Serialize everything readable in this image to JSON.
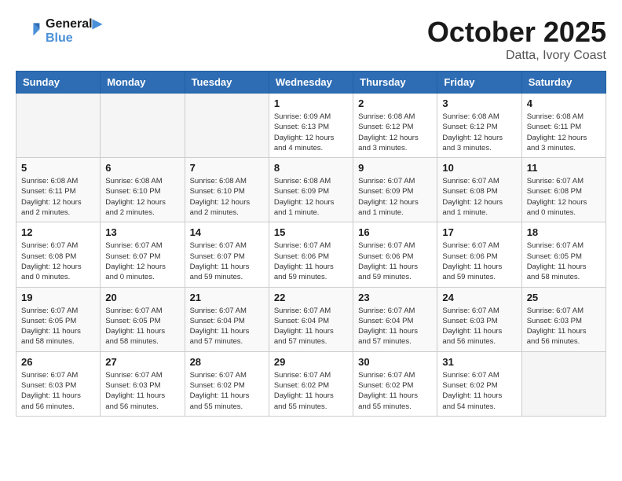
{
  "header": {
    "logo_line1": "General",
    "logo_line2": "Blue",
    "month_title": "October 2025",
    "location": "Datta, Ivory Coast"
  },
  "days_of_week": [
    "Sunday",
    "Monday",
    "Tuesday",
    "Wednesday",
    "Thursday",
    "Friday",
    "Saturday"
  ],
  "weeks": [
    [
      {
        "day": "",
        "empty": true
      },
      {
        "day": "",
        "empty": true
      },
      {
        "day": "",
        "empty": true
      },
      {
        "day": "1",
        "sunrise": "6:09 AM",
        "sunset": "6:13 PM",
        "daylight": "12 hours and 4 minutes."
      },
      {
        "day": "2",
        "sunrise": "6:08 AM",
        "sunset": "6:12 PM",
        "daylight": "12 hours and 3 minutes."
      },
      {
        "day": "3",
        "sunrise": "6:08 AM",
        "sunset": "6:12 PM",
        "daylight": "12 hours and 3 minutes."
      },
      {
        "day": "4",
        "sunrise": "6:08 AM",
        "sunset": "6:11 PM",
        "daylight": "12 hours and 3 minutes."
      }
    ],
    [
      {
        "day": "5",
        "sunrise": "6:08 AM",
        "sunset": "6:11 PM",
        "daylight": "12 hours and 2 minutes."
      },
      {
        "day": "6",
        "sunrise": "6:08 AM",
        "sunset": "6:10 PM",
        "daylight": "12 hours and 2 minutes."
      },
      {
        "day": "7",
        "sunrise": "6:08 AM",
        "sunset": "6:10 PM",
        "daylight": "12 hours and 2 minutes."
      },
      {
        "day": "8",
        "sunrise": "6:08 AM",
        "sunset": "6:09 PM",
        "daylight": "12 hours and 1 minute."
      },
      {
        "day": "9",
        "sunrise": "6:07 AM",
        "sunset": "6:09 PM",
        "daylight": "12 hours and 1 minute."
      },
      {
        "day": "10",
        "sunrise": "6:07 AM",
        "sunset": "6:08 PM",
        "daylight": "12 hours and 1 minute."
      },
      {
        "day": "11",
        "sunrise": "6:07 AM",
        "sunset": "6:08 PM",
        "daylight": "12 hours and 0 minutes."
      }
    ],
    [
      {
        "day": "12",
        "sunrise": "6:07 AM",
        "sunset": "6:08 PM",
        "daylight": "12 hours and 0 minutes."
      },
      {
        "day": "13",
        "sunrise": "6:07 AM",
        "sunset": "6:07 PM",
        "daylight": "12 hours and 0 minutes."
      },
      {
        "day": "14",
        "sunrise": "6:07 AM",
        "sunset": "6:07 PM",
        "daylight": "11 hours and 59 minutes."
      },
      {
        "day": "15",
        "sunrise": "6:07 AM",
        "sunset": "6:06 PM",
        "daylight": "11 hours and 59 minutes."
      },
      {
        "day": "16",
        "sunrise": "6:07 AM",
        "sunset": "6:06 PM",
        "daylight": "11 hours and 59 minutes."
      },
      {
        "day": "17",
        "sunrise": "6:07 AM",
        "sunset": "6:06 PM",
        "daylight": "11 hours and 59 minutes."
      },
      {
        "day": "18",
        "sunrise": "6:07 AM",
        "sunset": "6:05 PM",
        "daylight": "11 hours and 58 minutes."
      }
    ],
    [
      {
        "day": "19",
        "sunrise": "6:07 AM",
        "sunset": "6:05 PM",
        "daylight": "11 hours and 58 minutes."
      },
      {
        "day": "20",
        "sunrise": "6:07 AM",
        "sunset": "6:05 PM",
        "daylight": "11 hours and 58 minutes."
      },
      {
        "day": "21",
        "sunrise": "6:07 AM",
        "sunset": "6:04 PM",
        "daylight": "11 hours and 57 minutes."
      },
      {
        "day": "22",
        "sunrise": "6:07 AM",
        "sunset": "6:04 PM",
        "daylight": "11 hours and 57 minutes."
      },
      {
        "day": "23",
        "sunrise": "6:07 AM",
        "sunset": "6:04 PM",
        "daylight": "11 hours and 57 minutes."
      },
      {
        "day": "24",
        "sunrise": "6:07 AM",
        "sunset": "6:03 PM",
        "daylight": "11 hours and 56 minutes."
      },
      {
        "day": "25",
        "sunrise": "6:07 AM",
        "sunset": "6:03 PM",
        "daylight": "11 hours and 56 minutes."
      }
    ],
    [
      {
        "day": "26",
        "sunrise": "6:07 AM",
        "sunset": "6:03 PM",
        "daylight": "11 hours and 56 minutes."
      },
      {
        "day": "27",
        "sunrise": "6:07 AM",
        "sunset": "6:03 PM",
        "daylight": "11 hours and 56 minutes."
      },
      {
        "day": "28",
        "sunrise": "6:07 AM",
        "sunset": "6:02 PM",
        "daylight": "11 hours and 55 minutes."
      },
      {
        "day": "29",
        "sunrise": "6:07 AM",
        "sunset": "6:02 PM",
        "daylight": "11 hours and 55 minutes."
      },
      {
        "day": "30",
        "sunrise": "6:07 AM",
        "sunset": "6:02 PM",
        "daylight": "11 hours and 55 minutes."
      },
      {
        "day": "31",
        "sunrise": "6:07 AM",
        "sunset": "6:02 PM",
        "daylight": "11 hours and 54 minutes."
      },
      {
        "day": "",
        "empty": true
      }
    ]
  ],
  "labels": {
    "sunrise": "Sunrise:",
    "sunset": "Sunset:",
    "daylight": "Daylight:"
  }
}
